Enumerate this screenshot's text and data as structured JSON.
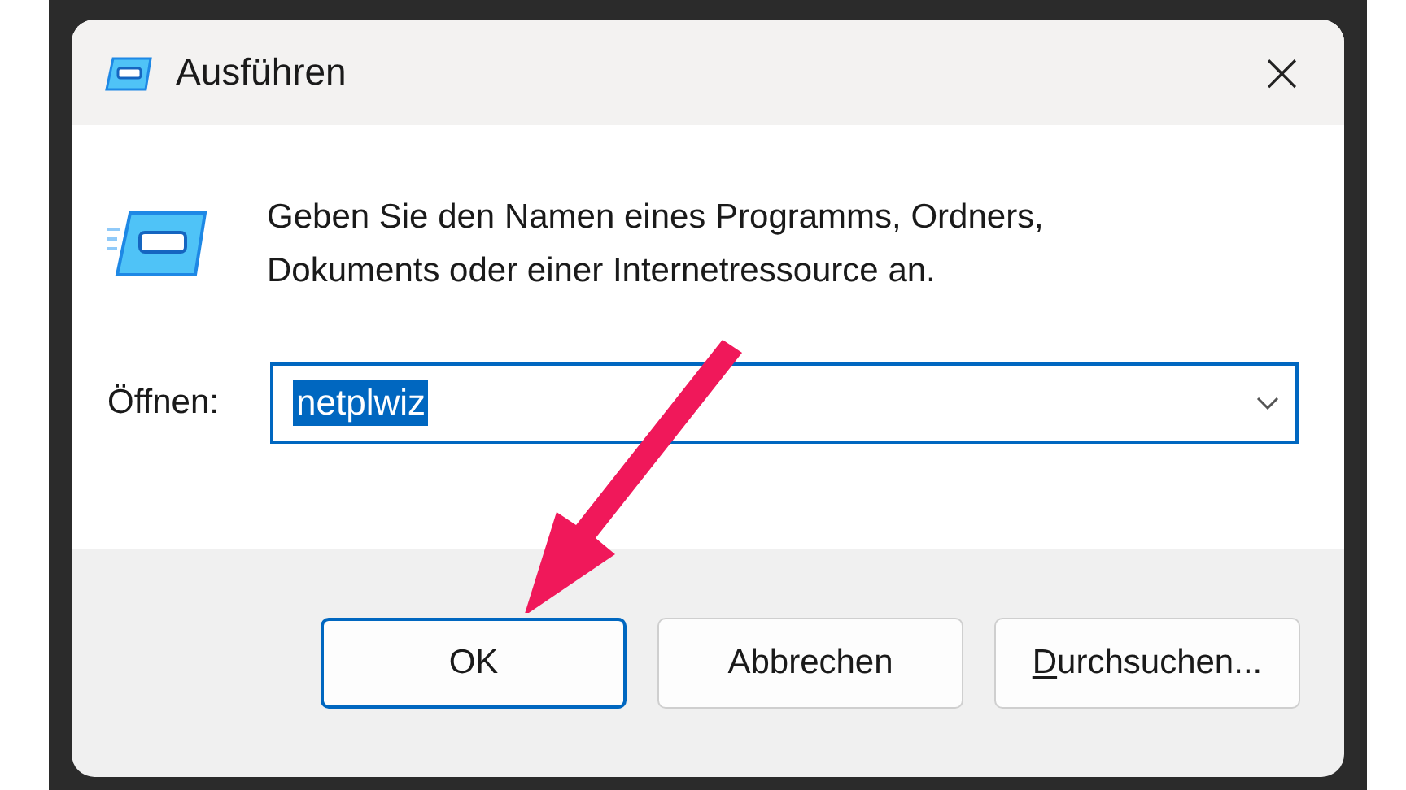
{
  "window": {
    "title": "Ausführen",
    "close": "×"
  },
  "prompt": "Geben Sie den Namen eines Programms, Ordners, Dokuments oder einer Internetressource an.",
  "open_field": {
    "label": "Öffnen:",
    "value": "netplwiz",
    "text_selected": true
  },
  "buttons": [
    {
      "label": "OK",
      "default": true,
      "access_key_underlined": false
    },
    {
      "label": "Abbrechen",
      "default": false,
      "access_key_underlined": false
    },
    {
      "label": "Durchsuchen...",
      "default": false,
      "access_key_underlined": true
    }
  ]
}
